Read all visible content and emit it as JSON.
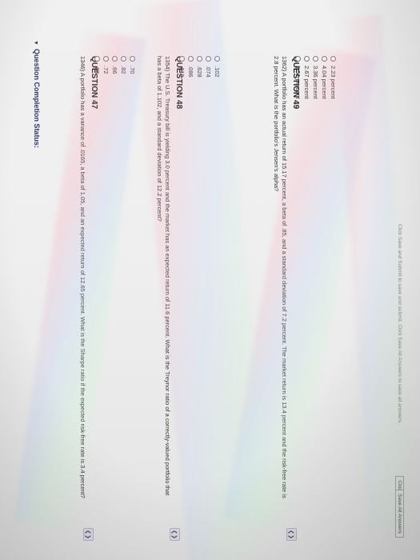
{
  "status_header": "Question Completion Status:",
  "questions": [
    {
      "title": "QUESTION 47",
      "text": "1346) A portfolio has a variance of .0165, a beta of 1.05, and an expected return of 12.65 percent. What is the Sharpe ratio if the expected risk-free rate is 3.4 percent?",
      "options": [
        ".70",
        ".82",
        ".66",
        ".72",
        ".86"
      ]
    },
    {
      "title": "QUESTION 48",
      "text": "1354) The U.S. Treasury bill is yielding 3.0 percent and the market has an expected return of 11.6 percent. What is the Treynor ratio of a correctly-valued portfolio that has a beta of 1.102, and a standard deviation of 12.2 percent?",
      "options": [
        ".102",
        ".074",
        ".628",
        ".086",
        ".619"
      ]
    },
    {
      "title": "QUESTION 49",
      "text": "1362) A portfolio has an actual return of 15.17 percent, a beta of .85, and a standard deviation of 7.2 percent. The market return is 13.4 percent and the risk-free rate is 2.8 percent. What is the portfolio's Jensen's alpha?",
      "options": [
        "2.23 percent",
        "4.04 percent",
        "3.36 percent",
        "2.67 percent",
        "2.51 percent"
      ]
    }
  ],
  "footer": {
    "hint": "Click Save and Submit to save and submit. Click Save All Answers to save all answers.",
    "save_all": "Save All Answers",
    "close": "Close"
  }
}
